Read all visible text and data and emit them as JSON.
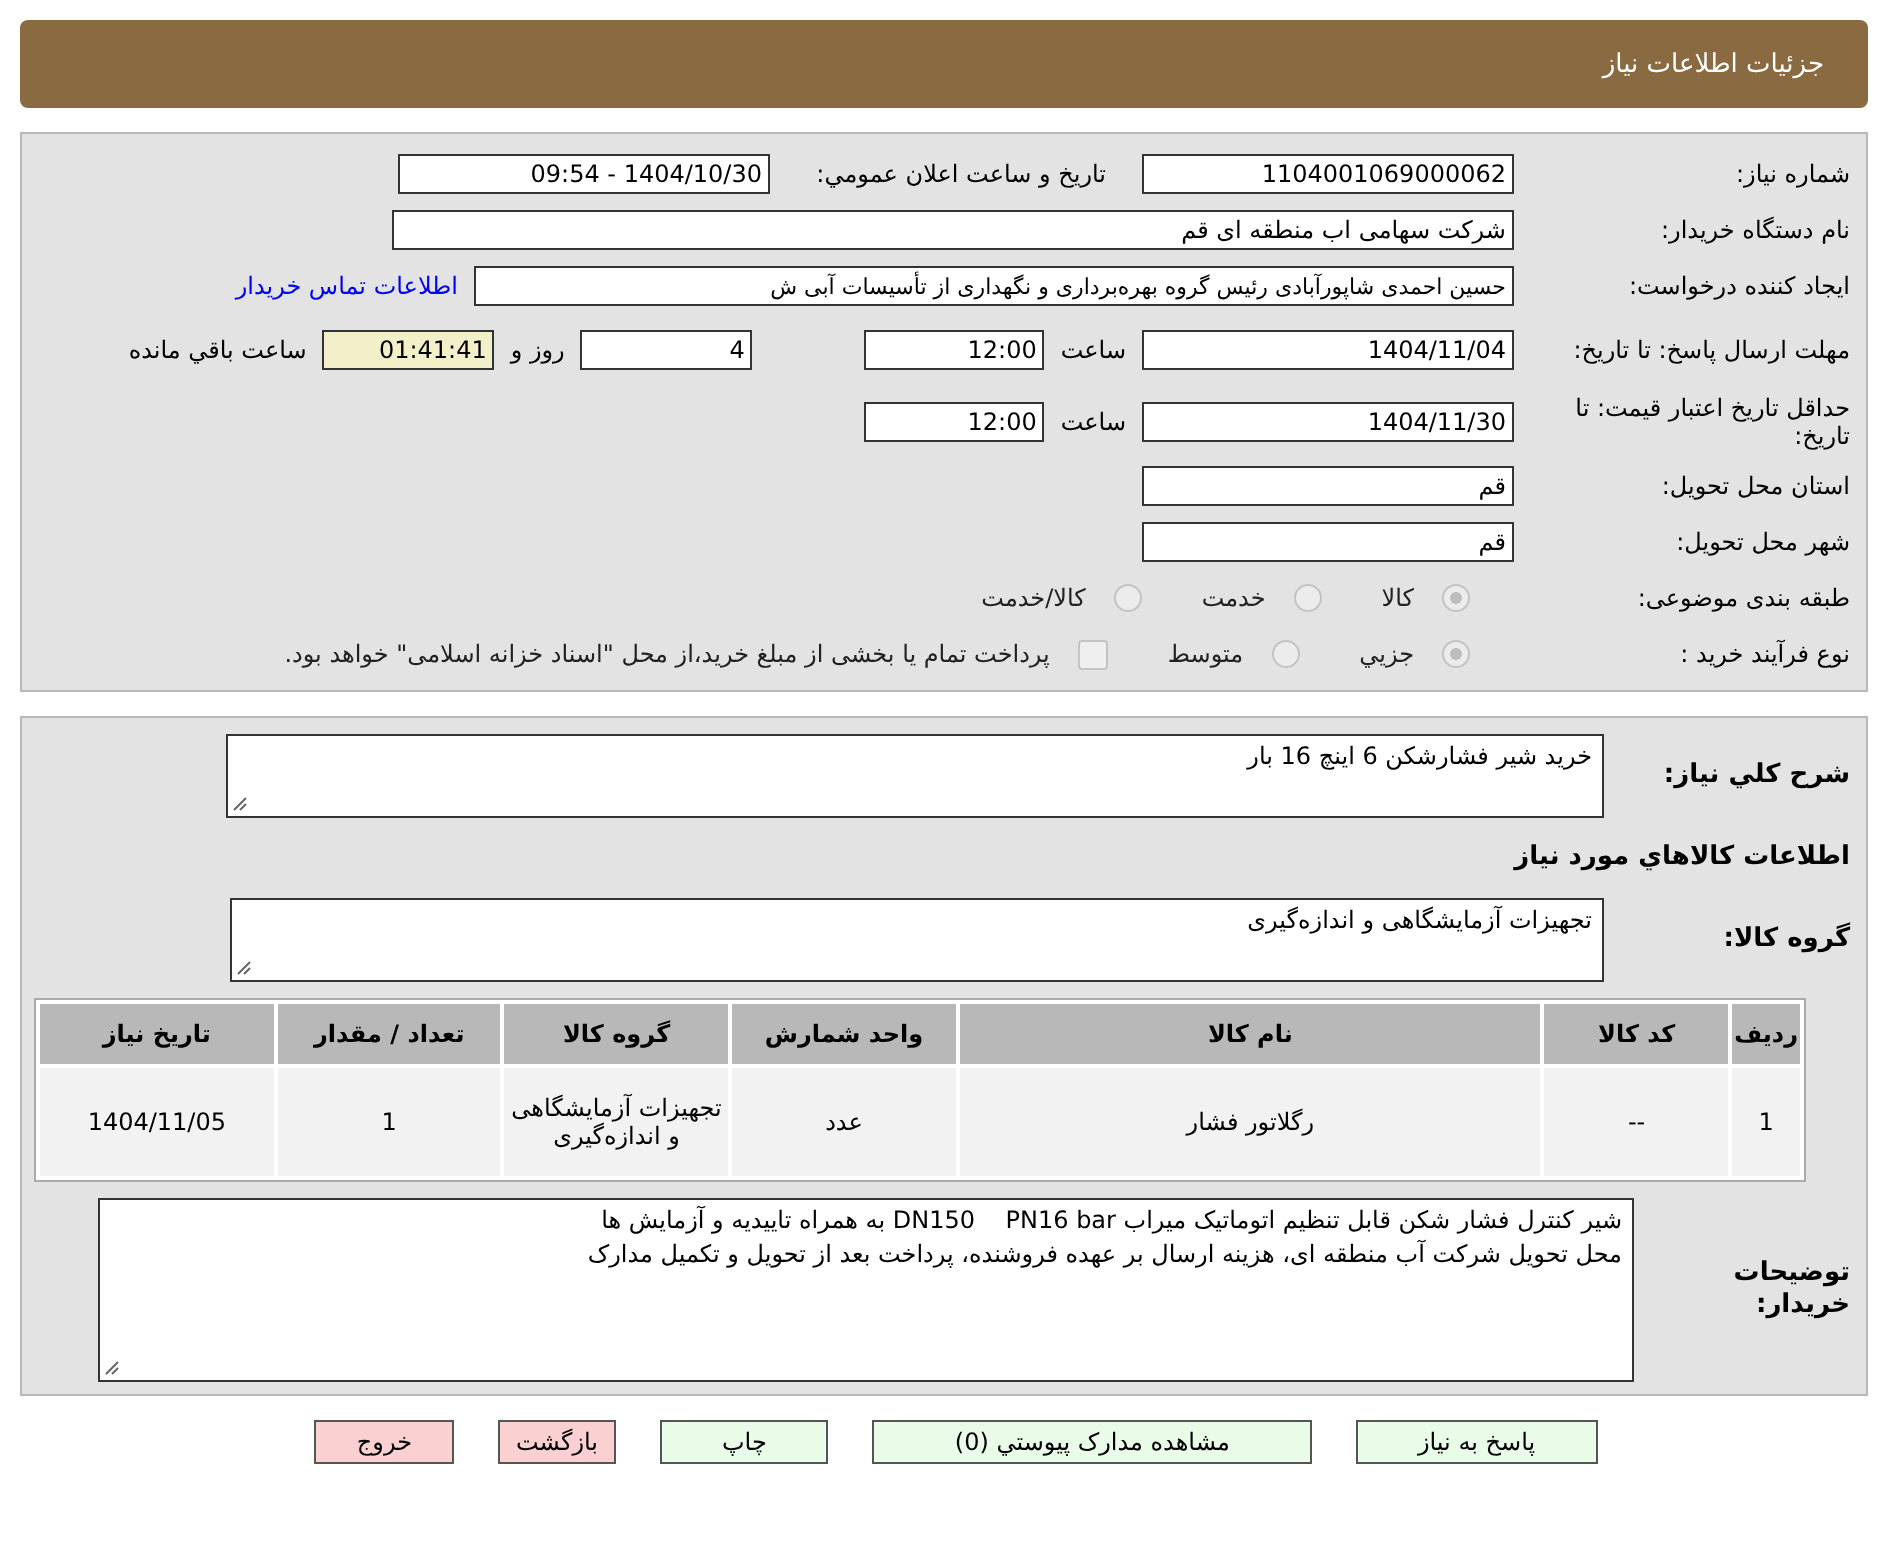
{
  "header": {
    "title": "جزئیات اطلاعات نیاز"
  },
  "need_number": {
    "label": "شماره نیاز:",
    "value": "1104001069000062"
  },
  "announce_date": {
    "label": "تاريخ و ساعت اعلان عمومي:",
    "value": "1404/10/30 - 09:54"
  },
  "buyer_org": {
    "label": "نام دستگاه خریدار:",
    "value": "شرکت سهامی اب منطقه ای قم"
  },
  "requester": {
    "label": "ایجاد کننده درخواست:",
    "value": "حسین احمدی شاپورآبادی رئیس گروه بهره‌برداری و نگهداری از تأسیسات آبی  ش",
    "link": "اطلاعات تماس خریدار"
  },
  "reply_deadline": {
    "label": "مهلت ارسال پاسخ: تا تاریخ:",
    "date": "1404/11/04",
    "time_label": "ساعت",
    "time": "12:00",
    "days": "4",
    "days_label": "روز و",
    "remaining": "01:41:41",
    "remaining_label": "ساعت باقي مانده"
  },
  "price_validity": {
    "label": "حداقل تاریخ اعتبار قیمت: تا تاریخ:",
    "date": "1404/11/30",
    "time_label": "ساعت",
    "time": "12:00"
  },
  "province": {
    "label": "استان محل تحویل:",
    "value": "قم"
  },
  "city": {
    "label": "شهر محل تحویل:",
    "value": "قم"
  },
  "category": {
    "label": "طبقه بندی موضوعی:",
    "options": [
      {
        "label": "كالا",
        "selected": true
      },
      {
        "label": "خدمت",
        "selected": false
      },
      {
        "label": "كالا/خدمت",
        "selected": false
      }
    ]
  },
  "purchase_type": {
    "label": "نوع فرآیند خرید :",
    "options": [
      {
        "label": "جزيي",
        "selected": true
      },
      {
        "label": "متوسط",
        "selected": false
      }
    ],
    "treasury": {
      "label": "پرداخت تمام یا بخشی از مبلغ خرید،از محل \"اسناد خزانه اسلامی\" خواهد بود.",
      "checked": false
    }
  },
  "description": {
    "label": "شرح كلي نياز:",
    "value": "خرید شیر فشارشکن 6 اینچ 16 بار"
  },
  "goods_heading": "اطلاعات كالاهاي مورد نياز",
  "goods_group": {
    "label": "گروه کالا:",
    "value": "تجهیزات آزمایشگاهی و اندازه‌گیری"
  },
  "table": {
    "columns": [
      "رديف",
      "کد کالا",
      "نام کالا",
      "واحد شمارش",
      "گروه کالا",
      "تعداد / مقدار",
      "تاریخ نیاز"
    ],
    "rows": [
      [
        "1",
        "--",
        "رگلاتور فشار",
        "عدد",
        "تجهیزات آزمایشگاهی و اندازه‌گیری",
        "1",
        "1404/11/05"
      ]
    ]
  },
  "buyer_notes": {
    "label": "توضیحات خریدار:",
    "lines": [
      "شیر کنترل فشار شکن قابل تنظیم اتوماتیک میراب DN150    PN16 bar به همراه تاییدیه و آزمایش ها",
      "محل تحویل شرکت آب منطقه ای، هزینه ارسال بر عهده فروشنده، پرداخت بعد از تحویل و تکمیل مدارک"
    ]
  },
  "buttons": [
    {
      "label": "پاسخ به نياز",
      "kind": "action"
    },
    {
      "label": "مشاهده مدارک پیوستي (0)",
      "kind": "action"
    },
    {
      "label": "چاپ",
      "kind": "action"
    },
    {
      "label": "بازگشت",
      "kind": "exit"
    },
    {
      "label": "خروج",
      "kind": "exit"
    }
  ]
}
